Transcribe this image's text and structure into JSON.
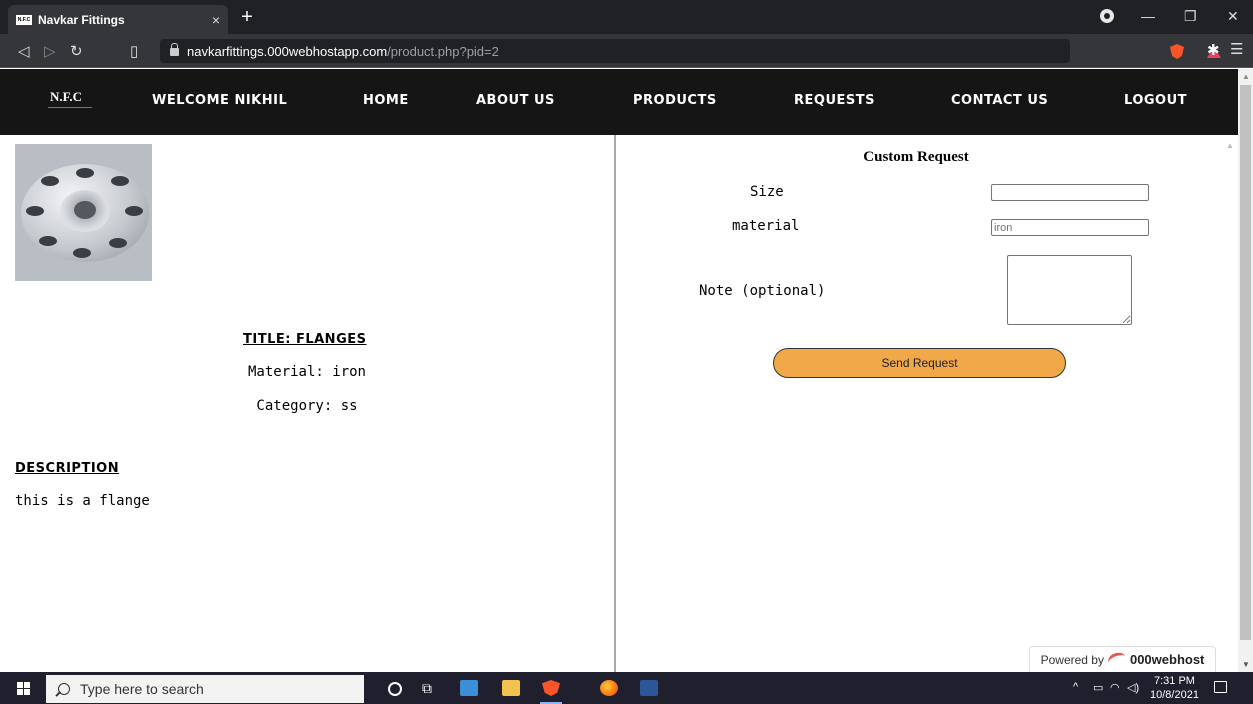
{
  "browser": {
    "tab_title": "Navkar Fittings",
    "tab_favicon_text": "N.F.C",
    "tab_close": "×",
    "new_tab": "+",
    "url_host": "navkarfittings.000webhostapp.com",
    "url_path": "/product.php?pid=2"
  },
  "nav": {
    "logo": "N.F.C",
    "items": [
      {
        "label": "WELCOME NIKHIL"
      },
      {
        "label": "HOME"
      },
      {
        "label": "ABOUT US"
      },
      {
        "label": "PRODUCTS"
      },
      {
        "label": "REQUESTS"
      },
      {
        "label": "CONTACT US"
      },
      {
        "label": "LOGOUT"
      }
    ]
  },
  "product": {
    "title": "Title: Flanges",
    "material": "Material: iron",
    "category": "Category: ss",
    "description_heading": "DESCRIPTION",
    "description": "this is a flange"
  },
  "request_form": {
    "title": "Custom Request",
    "size_label": "Size",
    "size_value": "",
    "material_label": "material",
    "material_placeholder": "iron",
    "note_label": "Note (optional)",
    "note_value": "",
    "submit_label": "Send Request"
  },
  "footer_badge": {
    "prefix": "Powered by",
    "brand": "000webhost"
  },
  "taskbar": {
    "search_placeholder": "Type here to search",
    "time": "7:31 PM",
    "date": "10/8/2021"
  },
  "colors": {
    "nav_bg": "#151515",
    "button_bg": "#f0a848",
    "taskbar_bg": "#1f1f2e"
  },
  "icons": [
    "windows-start-icon",
    "search-icon",
    "cortana-icon",
    "task-view-icon",
    "brave-icon",
    "firefox-icon",
    "word-icon",
    "lock-icon",
    "back-icon",
    "forward-icon",
    "reload-icon",
    "bookmark-icon",
    "extensions-icon",
    "menu-icon"
  ]
}
